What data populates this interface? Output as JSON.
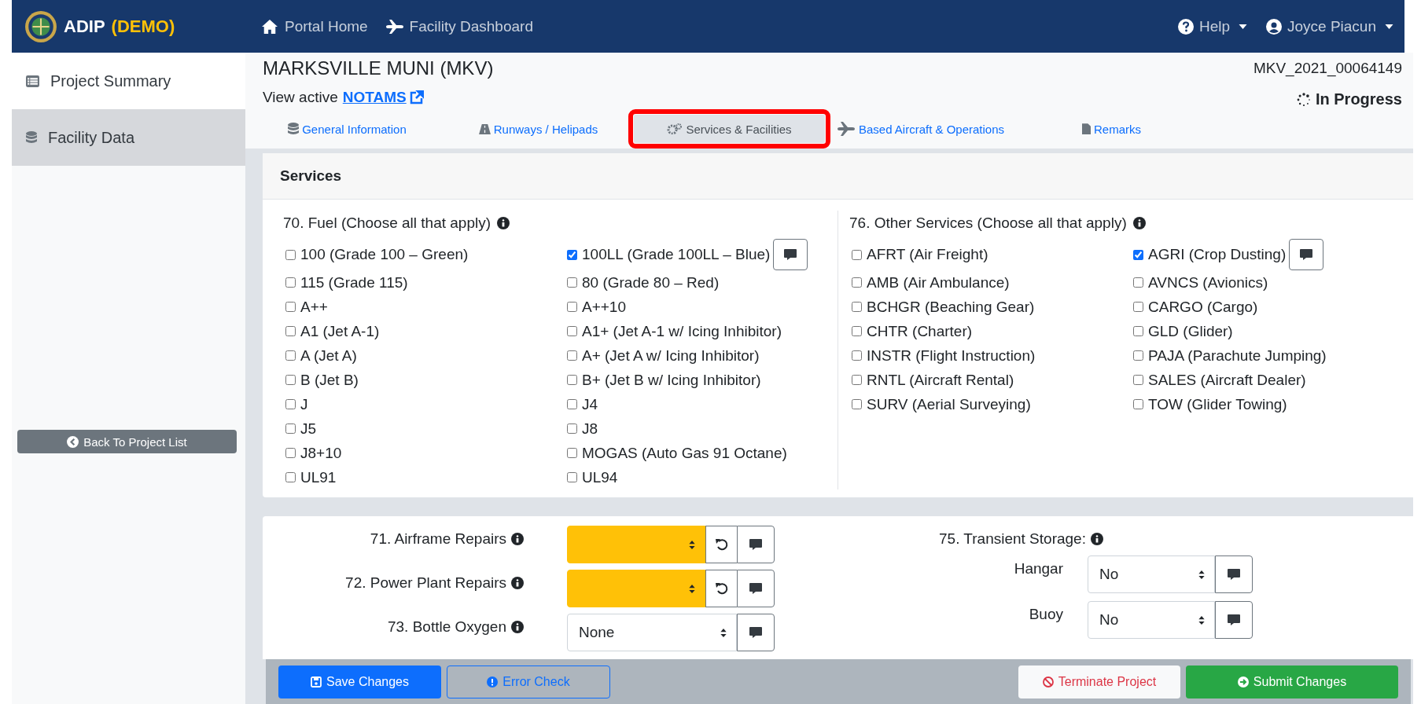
{
  "navbar": {
    "brand": "ADIP",
    "brand_tag": "(DEMO)",
    "links": [
      {
        "label": "Portal Home",
        "kind": "home"
      },
      {
        "label": "Facility Dashboard",
        "kind": "plane"
      }
    ],
    "help": "Help",
    "user": "Joyce Piacun"
  },
  "sidebar": {
    "items": [
      {
        "label": "Project Summary",
        "kind": "list",
        "selected": false
      },
      {
        "label": "Facility Data",
        "kind": "database",
        "selected": true
      }
    ],
    "back_button": "Back To Project List"
  },
  "header": {
    "title": "MARKSVILLE MUNI (MKV)",
    "notams_prefix": "View active",
    "notams_link": "NOTAMS",
    "project_id": "MKV_2021_00064149",
    "status": "In Progress"
  },
  "tabs": [
    {
      "label": "General Information",
      "kind": "database",
      "selected": false
    },
    {
      "label": "Runways / Helipads",
      "kind": "road",
      "selected": false
    },
    {
      "label": "Services & Facilities",
      "kind": "gears",
      "selected": true
    },
    {
      "label": "Based Aircraft & Operations",
      "kind": "plane",
      "selected": false
    },
    {
      "label": "Remarks",
      "kind": "file",
      "selected": false
    }
  ],
  "services": {
    "title": "Services",
    "groups": [
      {
        "label": "70. Fuel (Choose all that apply)",
        "options": [
          {
            "label": "100 (Grade 100 – Green)",
            "checked": false
          },
          {
            "label": "100LL (Grade 100LL – Blue)",
            "checked": true
          },
          {
            "label": "115 (Grade 115)",
            "checked": false
          },
          {
            "label": "80 (Grade 80 – Red)",
            "checked": false
          },
          {
            "label": "A++",
            "checked": false
          },
          {
            "label": "A++10",
            "checked": false
          },
          {
            "label": "A1 (Jet A-1)",
            "checked": false
          },
          {
            "label": "A1+ (Jet A-1 w/ Icing Inhibitor)",
            "checked": false
          },
          {
            "label": "A (Jet A)",
            "checked": false
          },
          {
            "label": "A+ (Jet A w/ Icing Inhibitor)",
            "checked": false
          },
          {
            "label": "B (Jet B)",
            "checked": false
          },
          {
            "label": "B+ (Jet B w/ Icing Inhibitor)",
            "checked": false
          },
          {
            "label": "J",
            "checked": false
          },
          {
            "label": "J4",
            "checked": false
          },
          {
            "label": "J5",
            "checked": false
          },
          {
            "label": "J8",
            "checked": false
          },
          {
            "label": "J8+10",
            "checked": false
          },
          {
            "label": "MOGAS (Auto Gas 91 Octane)",
            "checked": false
          },
          {
            "label": "UL91",
            "checked": false
          },
          {
            "label": "UL94",
            "checked": false
          }
        ]
      },
      {
        "label": "76. Other Services (Choose all that apply)",
        "options": [
          {
            "label": "AFRT (Air Freight)",
            "checked": false
          },
          {
            "label": "AGRI (Crop Dusting)",
            "checked": true
          },
          {
            "label": "AMB (Air Ambulance)",
            "checked": false
          },
          {
            "label": "AVNCS (Avionics)",
            "checked": false
          },
          {
            "label": "BCHGR (Beaching Gear)",
            "checked": false
          },
          {
            "label": "CARGO (Cargo)",
            "checked": false
          },
          {
            "label": "CHTR (Charter)",
            "checked": false
          },
          {
            "label": "GLD (Glider)",
            "checked": false
          },
          {
            "label": "INSTR (Flight Instruction)",
            "checked": false
          },
          {
            "label": "PAJA (Parachute Jumping)",
            "checked": false
          },
          {
            "label": "RNTL (Aircraft Rental)",
            "checked": false
          },
          {
            "label": "SALES (Aircraft Dealer)",
            "checked": false
          },
          {
            "label": "SURV (Aerial Surveying)",
            "checked": false
          },
          {
            "label": "TOW (Glider Towing)",
            "checked": false
          }
        ]
      }
    ]
  },
  "facility_fields": [
    {
      "label": "71. Airframe Repairs",
      "highlighted": true
    },
    {
      "label": "72. Power Plant Repairs",
      "highlighted": true
    },
    {
      "label": "73. Bottle Oxygen",
      "value": "None",
      "highlighted": false
    }
  ],
  "transient_storage": {
    "label": "75. Transient Storage:",
    "rows": [
      {
        "label": "Hangar",
        "value": "No"
      },
      {
        "label": "Buoy",
        "value": "No"
      }
    ]
  },
  "footer": {
    "buttons": [
      {
        "label": "Save Changes",
        "kind": "save"
      },
      {
        "label": "Error Check",
        "kind": "check"
      },
      {
        "label": "Terminate Project",
        "kind": "terminate"
      },
      {
        "label": "Submit Changes",
        "kind": "submit"
      }
    ]
  }
}
